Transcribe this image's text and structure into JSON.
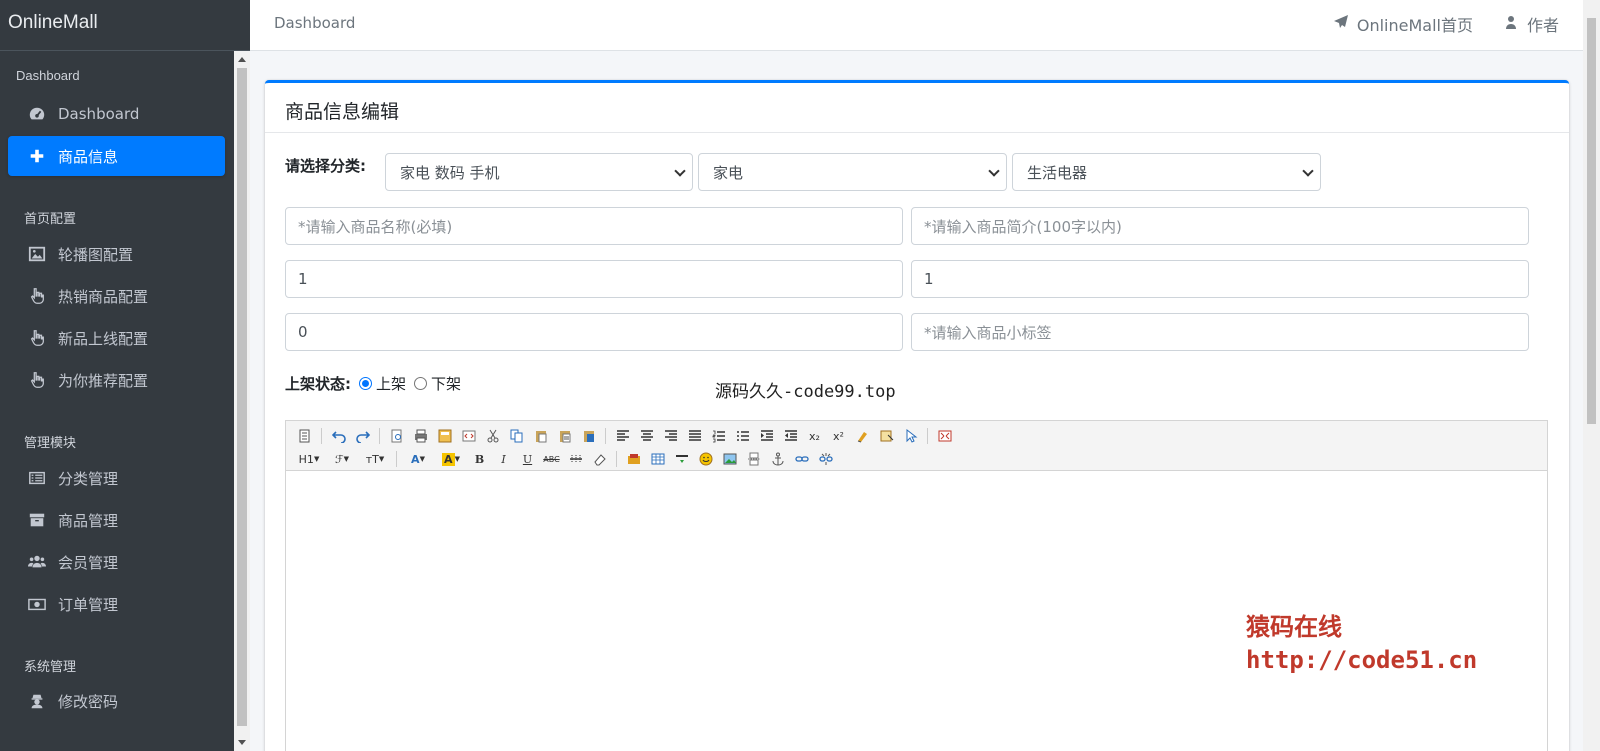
{
  "brand": "OnlineMall",
  "sidebar": {
    "headers": [
      "Dashboard",
      "首页配置",
      "管理模块",
      "系统管理"
    ],
    "items": [
      {
        "label": "Dashboard",
        "icon": "dashboard-icon"
      },
      {
        "label": "商品信息",
        "icon": "plus-icon",
        "active": true
      },
      {
        "label": "轮播图配置",
        "icon": "image-icon"
      },
      {
        "label": "热销商品配置",
        "icon": "hand-pointer-icon"
      },
      {
        "label": "新品上线配置",
        "icon": "hand-pointer-icon"
      },
      {
        "label": "为你推荐配置",
        "icon": "hand-pointer-icon"
      },
      {
        "label": "分类管理",
        "icon": "list-icon"
      },
      {
        "label": "商品管理",
        "icon": "archive-icon"
      },
      {
        "label": "会员管理",
        "icon": "users-icon"
      },
      {
        "label": "订单管理",
        "icon": "money-icon"
      },
      {
        "label": "修改密码",
        "icon": "user-secret-icon"
      }
    ]
  },
  "topbar": {
    "breadcrumb": "Dashboard",
    "home_link": "OnlineMall首页",
    "author_link": "作者"
  },
  "card": {
    "title": "商品信息编辑",
    "category_label": "请选择分类:",
    "category_selects": [
      "家电 数码 手机",
      "家电",
      "生活电器"
    ],
    "name_placeholder": "*请输入商品名称(必填)",
    "intro_placeholder": "*请输入商品简介(100字以内)",
    "original_price": "1",
    "selling_price": "1",
    "stock": "0",
    "tag_placeholder": "*请输入商品小标签",
    "status_label": "上架状态:",
    "status_on": "上架",
    "status_off": "下架",
    "watermark_top": "源码久久-code99.top",
    "watermark_line1": "猿码在线",
    "watermark_line2": "http://code51.cn"
  },
  "editor": {
    "heading_btn": "H1",
    "font_btn": "ℱ",
    "size_btn": "тT",
    "fontcolor_btn": "A",
    "bgcolor_btn": "A",
    "bold_btn": "B",
    "italic_btn": "I",
    "underline_btn": "U",
    "strike_btn": "ABC",
    "sub_btn": "x₂",
    "sup_btn": "x²"
  },
  "colors": {
    "sidebar_bg": "#343a40",
    "accent": "#007bff",
    "watermark_red": "#c0392b"
  }
}
